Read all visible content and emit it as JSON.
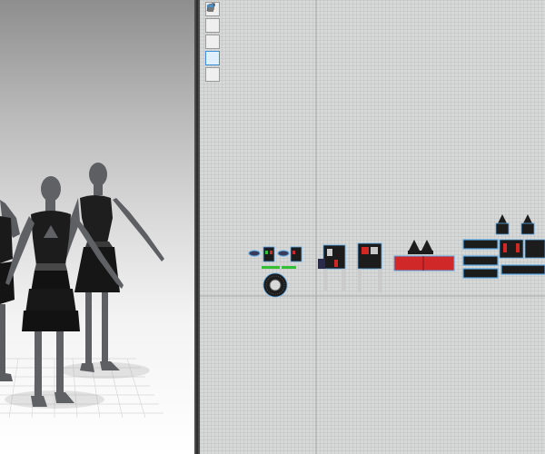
{
  "toolbar_2d": {
    "tools": [
      {
        "name": "select-move-tool",
        "icon": "arrow-icon"
      },
      {
        "name": "transform-pattern-tool",
        "icon": "transform-icon"
      },
      {
        "name": "edit-point-tool",
        "icon": "point-icon"
      },
      {
        "name": "edit-texture-tool",
        "icon": "texture-icon"
      },
      {
        "name": "lock-tool",
        "icon": "lock-icon"
      }
    ]
  },
  "colors": {
    "pattern_selection": "#5aa9e6",
    "pattern_fill": "#1c1c1c",
    "accent_red": "#d02828",
    "accent_green": "#34c034",
    "avatar": "#595b5f"
  },
  "scene": {
    "avatars": [
      {
        "name": "avatar-left-partial",
        "garment": "black-dress"
      },
      {
        "name": "avatar-center",
        "garment": "black-tiered-dress"
      },
      {
        "name": "avatar-right",
        "garment": "black-halter-dress"
      }
    ]
  }
}
